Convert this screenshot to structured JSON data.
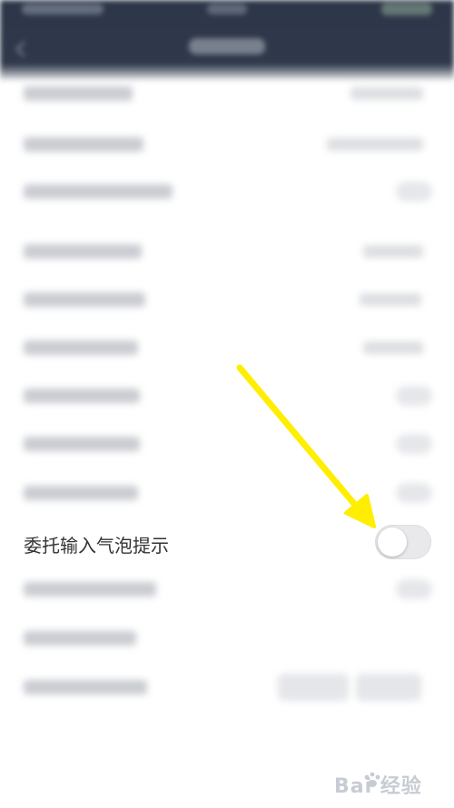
{
  "settings": {
    "delegate_bubble": {
      "label": "委托输入气泡提示",
      "enabled": false
    }
  },
  "watermark": {
    "text": "Bai 经验",
    "icon": "paw-logo-icon"
  },
  "colors": {
    "header_bg": "#2f394b",
    "toggle_off_track": "#e9e9eb",
    "arrow_annotation": "#ffee00",
    "label_text": "#333333"
  }
}
